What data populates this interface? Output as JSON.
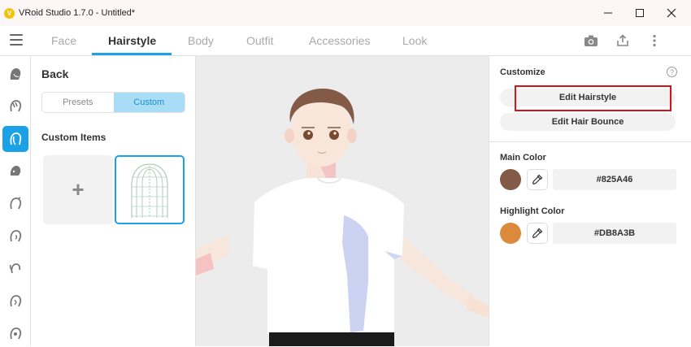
{
  "window": {
    "title": "VRoid Studio 1.7.0 - Untitled*",
    "app_icon": "vroid-icon"
  },
  "tabs": [
    {
      "label": "Face",
      "active": false
    },
    {
      "label": "Hairstyle",
      "active": true
    },
    {
      "label": "Body",
      "active": false
    },
    {
      "label": "Outfit",
      "active": false
    },
    {
      "label": "Accessories",
      "active": false
    },
    {
      "label": "Look",
      "active": false
    }
  ],
  "toolbar_icons": [
    "camera-icon",
    "share-icon",
    "more-icon"
  ],
  "left_rail": {
    "items": [
      "hair-base-icon",
      "front-hair-icon",
      "back-hair-icon",
      "side-hair-icon",
      "ahoge-icon",
      "ear-hair-icon",
      "ponytail-icon",
      "braid-icon",
      "misc-hair-icon"
    ],
    "active_index": 2
  },
  "panel": {
    "back_label": "Back",
    "segment": {
      "options": [
        "Presets",
        "Custom"
      ],
      "selected": "Custom"
    },
    "custom_items_title": "Custom Items",
    "add_symbol": "+"
  },
  "customize": {
    "title": "Customize",
    "help": "?",
    "edit_hairstyle": "Edit Hairstyle",
    "edit_hair_bounce": "Edit Hair Bounce"
  },
  "main_color": {
    "label": "Main Color",
    "hex": "#825A46",
    "swatch": "#825a46"
  },
  "highlight_color": {
    "label": "Highlight Color",
    "hex": "#DB8A3B",
    "swatch": "#db8a3b"
  },
  "accent_color": "#1aa1e6",
  "highlight_box_color": "#d3141b"
}
